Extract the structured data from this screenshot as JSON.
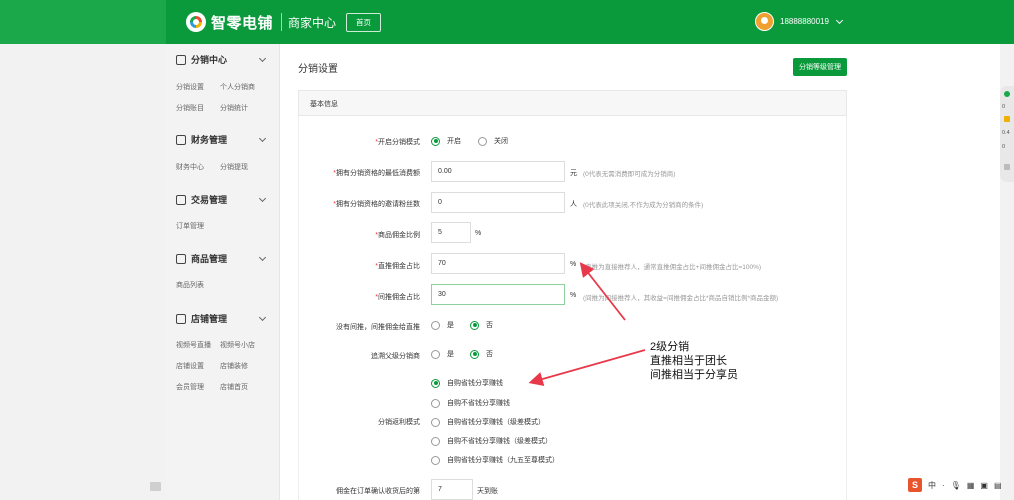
{
  "header": {
    "logo_text": "智零电铺",
    "sub_title": "商家中心",
    "home_label": "首页",
    "user_phone": "18888880019"
  },
  "sidebar": {
    "sections": [
      {
        "title": "分销中心",
        "icon": "share-icon",
        "items": [
          "分销设置",
          "个人分销商",
          "分销账目",
          "分销统计"
        ]
      },
      {
        "title": "财务管理",
        "icon": "wallet-icon",
        "items": [
          "财务中心",
          "分销提现"
        ]
      },
      {
        "title": "交易管理",
        "icon": "clipboard-icon",
        "items": [
          "订单管理"
        ]
      },
      {
        "title": "商品管理",
        "icon": "bag-icon",
        "items": [
          "商品列表"
        ]
      },
      {
        "title": "店铺管理",
        "icon": "store-icon",
        "items": [
          "视频号直播",
          "视频号小店",
          "店铺设置",
          "店铺装修",
          "会员管理",
          "店铺首页"
        ]
      }
    ]
  },
  "page": {
    "title": "分销设置",
    "level_manage_btn": "分销等级管理",
    "panel_title": "基本信息"
  },
  "form": {
    "enable_mode": {
      "label": "开启分销模式",
      "on": "开启",
      "off": "关闭"
    },
    "min_consume": {
      "label": "拥有分销资格的最低消费额",
      "value": "0.00",
      "unit": "元",
      "hint": "(0代表无需消费即可成为分销商)"
    },
    "invite_fans": {
      "label": "拥有分销资格的邀请粉丝数",
      "value": "0",
      "unit": "人",
      "hint": "(0代表此项关闭,不作为成为分销商的条件)"
    },
    "commission_ratio": {
      "label": "商品佣金比例",
      "value": "5",
      "unit": "%"
    },
    "direct_ratio": {
      "label": "直推佣金占比",
      "value": "70",
      "unit": "%",
      "hint": "(直推为直接推荐人，通常直推佣金占比+间推佣金占比=100%)"
    },
    "indirect_ratio": {
      "label": "间推佣金占比",
      "value": "30",
      "unit": "%",
      "hint": "(间推为间接推荐人，其收益=间推佣金占比*商品自销比例*商品金额)"
    },
    "no_indirect": {
      "label": "没有间推，间推佣金给直推",
      "yes": "是",
      "no": "否"
    },
    "trace_parent": {
      "label": "追溯父级分销商",
      "yes": "是",
      "no": "否"
    },
    "rebate_mode": {
      "label": "分销返利模式",
      "options": [
        "自购省钱分享赚钱",
        "自购不省钱分享赚钱",
        "自购省钱分享赚钱（级差模式）",
        "自购不省钱分享赚钱（级差模式）",
        "自购省钱分享赚钱（九五至尊模式）"
      ],
      "selected": 0
    },
    "settle_days": {
      "label": "佣金在订单确认收货后的第",
      "value": "7",
      "unit": "天到账"
    }
  },
  "annotation": {
    "line1": "2级分销",
    "line2": "直推相当于团长",
    "line3": "间推相当于分享员",
    "arrow_color": "#e8394a"
  },
  "right_tool": {
    "v1": "0",
    "v2": "0.4",
    "v3": "0"
  },
  "ime": {
    "lang": "中"
  },
  "colors": {
    "brand": "#0a9a3c",
    "required": "#e33333",
    "annotation_arrow": "#e8394a"
  }
}
